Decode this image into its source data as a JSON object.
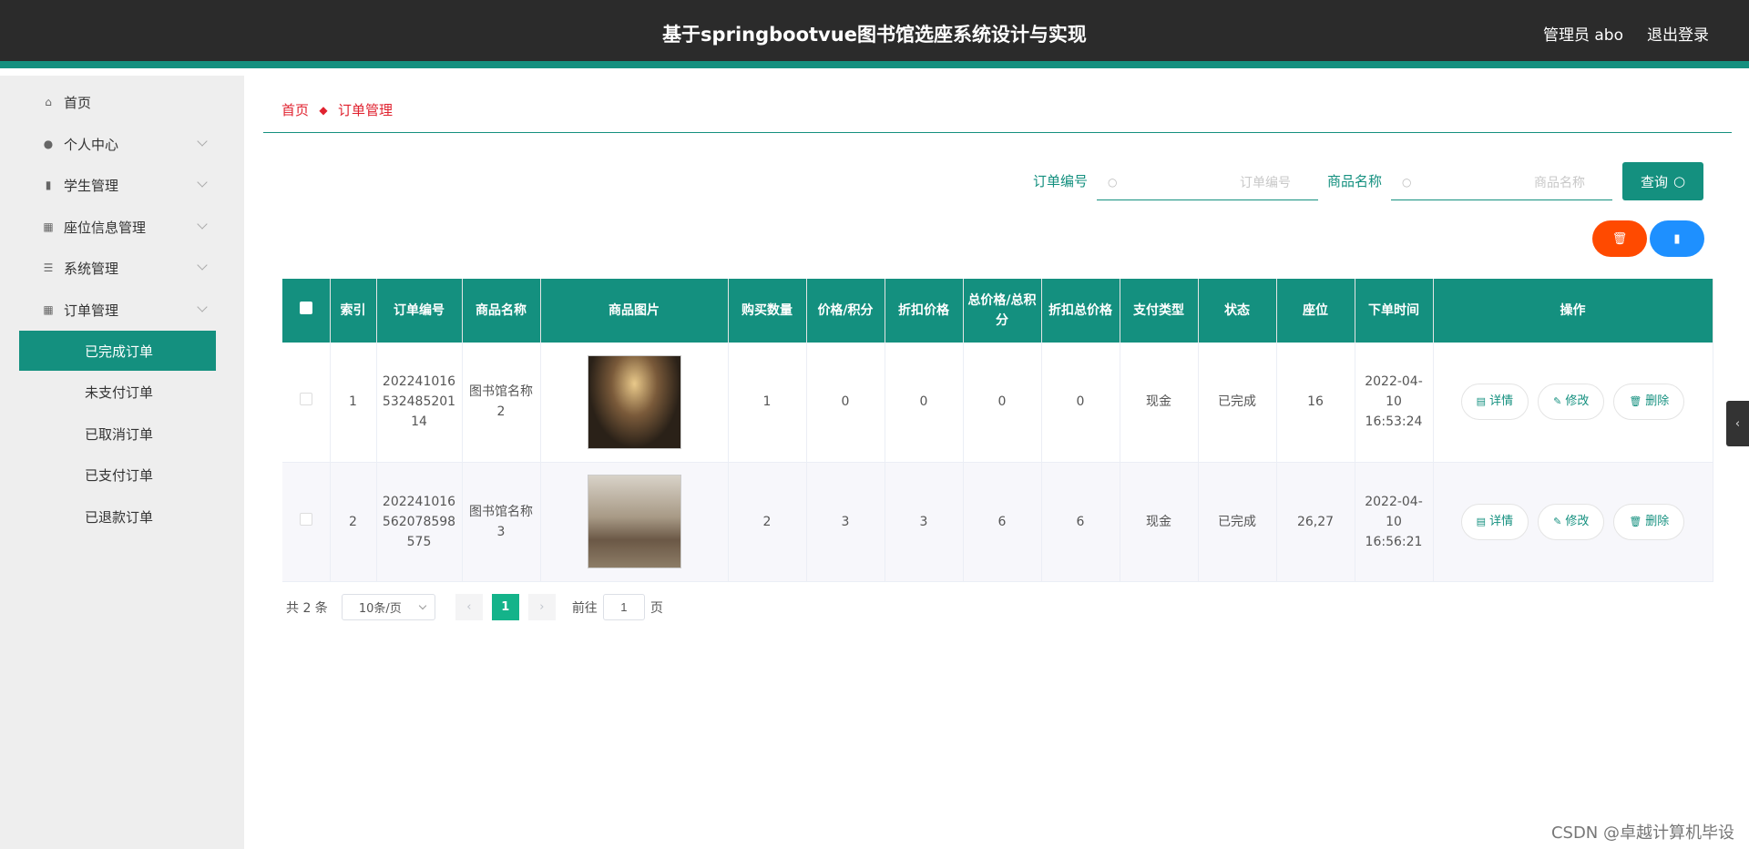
{
  "header": {
    "title": "基于springbootvue图书馆选座系统设计与实现",
    "user": "管理员 abo",
    "logout": "退出登录"
  },
  "sidebar": {
    "items": [
      {
        "label": "首页"
      },
      {
        "label": "个人中心"
      },
      {
        "label": "学生管理"
      },
      {
        "label": "座位信息管理"
      },
      {
        "label": "系统管理"
      },
      {
        "label": "订单管理"
      }
    ],
    "sub_items": [
      {
        "label": "已完成订单"
      },
      {
        "label": "未支付订单"
      },
      {
        "label": "已取消订单"
      },
      {
        "label": "已支付订单"
      },
      {
        "label": "已退款订单"
      }
    ]
  },
  "breadcrumb": {
    "home": "首页",
    "current": "订单管理"
  },
  "search": {
    "order_no_label": "订单编号",
    "order_no_placeholder": "订单编号",
    "product_label": "商品名称",
    "product_placeholder": "商品名称",
    "query_label": "查询"
  },
  "table": {
    "headers": [
      "索引",
      "订单编号",
      "商品名称",
      "商品图片",
      "购买数量",
      "价格/积分",
      "折扣价格",
      "总价格/总积分",
      "折扣总价格",
      "支付类型",
      "状态",
      "座位",
      "下单时间",
      "操作"
    ],
    "rows": [
      {
        "index": "1",
        "order_no": "2022410165324852​0114",
        "product": "图书馆名称2",
        "qty": "1",
        "price": "0",
        "discount": "0",
        "total": "0",
        "discount_total": "0",
        "pay_type": "现金",
        "status": "已完成",
        "seat": "16",
        "time": "2022-04-10 16:53:24"
      },
      {
        "index": "2",
        "order_no": "2022410165620785​98575",
        "product": "图书馆名称3",
        "qty": "2",
        "price": "3",
        "discount": "3",
        "total": "6",
        "discount_total": "6",
        "pay_type": "现金",
        "status": "已完成",
        "seat": "26,27",
        "time": "2022-04-10 16:56:21"
      }
    ],
    "actions": {
      "detail": "详情",
      "edit": "修改",
      "delete": "删除"
    }
  },
  "pager": {
    "total": "共 2 条",
    "page_size": "10条/页",
    "current": "1",
    "goto_prefix": "前往",
    "goto_value": "1",
    "goto_suffix": "页"
  },
  "watermark": "CSDN @卓越计算机毕设",
  "colors": {
    "primary": "#14907f",
    "topbar": "#2b2b2b",
    "danger": "#ff4a00",
    "info": "#1e90ff",
    "breadcrumb": "#e0222f"
  }
}
